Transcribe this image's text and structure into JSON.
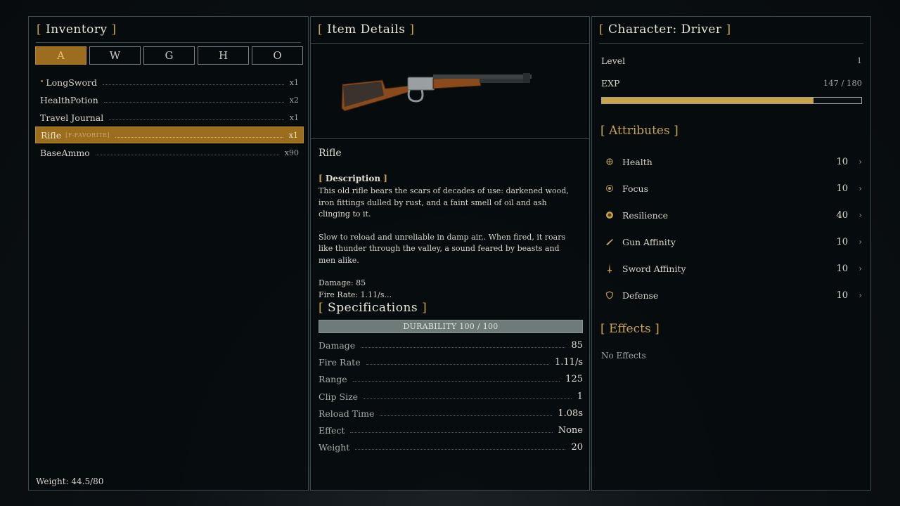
{
  "inventory": {
    "title": "Inventory",
    "tabs": [
      "A",
      "W",
      "G",
      "H",
      "O"
    ],
    "active_tab": "A",
    "items": [
      {
        "name": "LongSword",
        "tag": "",
        "qty": "x1",
        "marked": true
      },
      {
        "name": "HealthPotion",
        "tag": "",
        "qty": "x2",
        "marked": false
      },
      {
        "name": "Travel Journal",
        "tag": "",
        "qty": "x1",
        "marked": false
      },
      {
        "name": "Rifle",
        "tag": "[F-FAVORITE]",
        "qty": "x1",
        "marked": false
      },
      {
        "name": "BaseAmmo",
        "tag": "",
        "qty": "x90",
        "marked": false
      }
    ],
    "selected_index": 3,
    "weight_text": "Weight: 44.5/80"
  },
  "details": {
    "title": "Item Details",
    "item_image": "rifle-image",
    "item_name": "Rifle",
    "description_heading": "Description",
    "description_p1": "This old rifle bears the scars of decades of use: darkened wood, iron fittings dulled by rust, and a faint smell of oil and ash clinging to it.",
    "description_p2": "Slow to reload and unreliable in damp air,. When fired, it roars like thunder through the valley, a sound feared by beasts and men alike.",
    "description_damage": "Damage: 85",
    "description_firerate": "Fire Rate: 1.11/s...",
    "spec_title": "Specifications",
    "durability_text": "DURABILITY  100 / 100",
    "durability_fraction": 1.0,
    "specs": [
      {
        "label": "Damage",
        "value": "85"
      },
      {
        "label": "Fire Rate",
        "value": "1.11/s"
      },
      {
        "label": "Range",
        "value": "125"
      },
      {
        "label": "Clip Size",
        "value": "1"
      },
      {
        "label": "Reload Time",
        "value": "1.08s"
      },
      {
        "label": "Effect",
        "value": "None"
      },
      {
        "label": "Weight",
        "value": "20"
      }
    ]
  },
  "character": {
    "title": "Character: Driver",
    "level_label": "Level",
    "level_value": "1",
    "exp_label": "EXP",
    "exp_value": "147 / 180",
    "exp_fraction": 0.8167,
    "attributes_title": "Attributes",
    "attributes": [
      {
        "label": "Health",
        "value": "10",
        "icon": "health-icon"
      },
      {
        "label": "Focus",
        "value": "10",
        "icon": "focus-icon"
      },
      {
        "label": "Resilience",
        "value": "40",
        "icon": "resilience-icon"
      },
      {
        "label": "Gun Affinity",
        "value": "10",
        "icon": "gun-icon"
      },
      {
        "label": "Sword Affinity",
        "value": "10",
        "icon": "sword-icon"
      },
      {
        "label": "Defense",
        "value": "10",
        "icon": "shield-icon"
      }
    ],
    "effects_title": "Effects",
    "effects_text": "No Effects"
  },
  "colors": {
    "accent": "#c9a24a",
    "selected_bg": "#9a6e1e",
    "panel_border": "#3b4a4c",
    "durability_bar": "#6e7b78"
  }
}
